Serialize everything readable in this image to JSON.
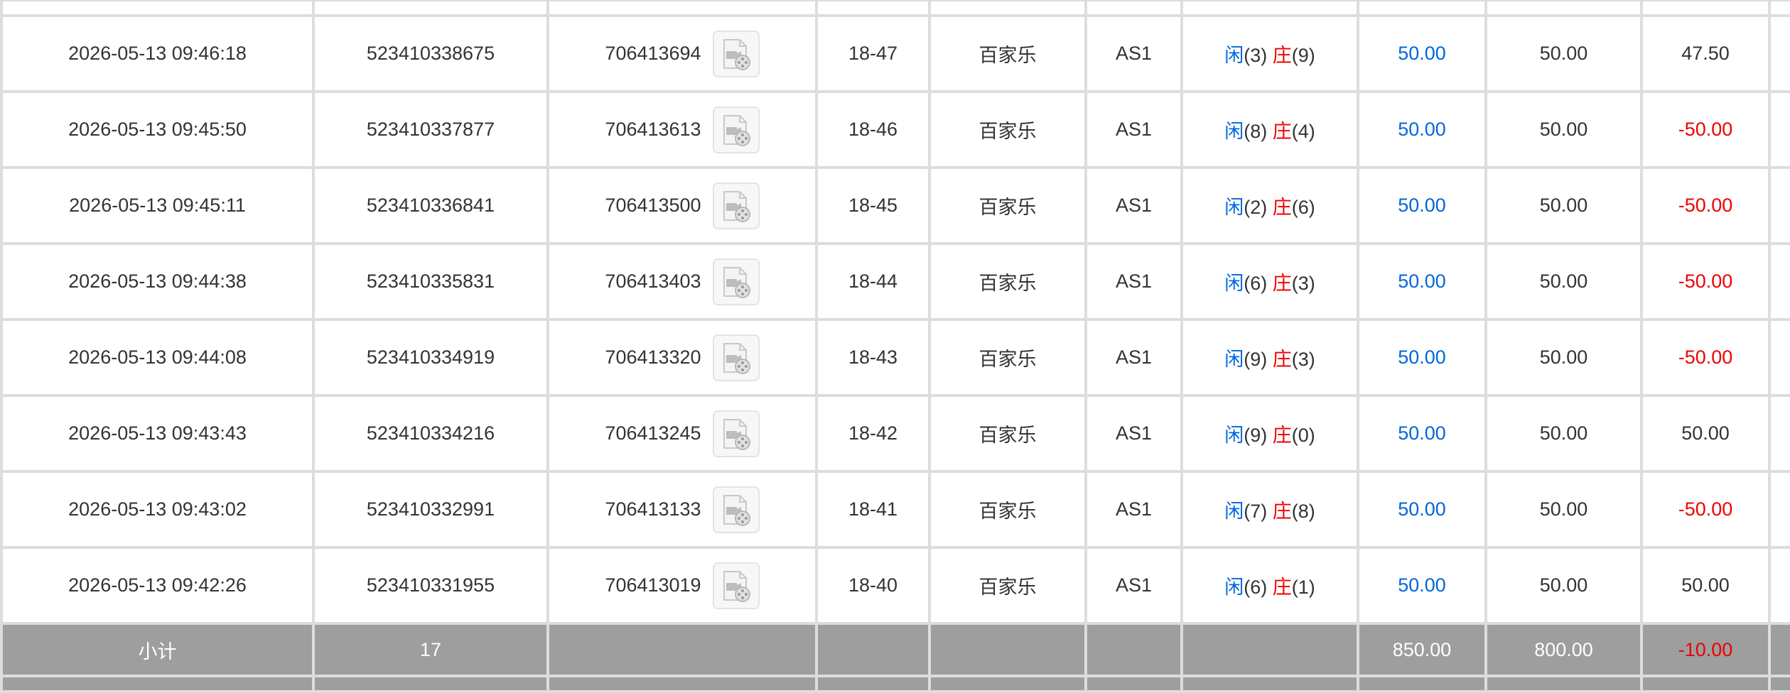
{
  "colors": {
    "blue": "#0066dd",
    "red": "#ee0000",
    "border": "#dddddd",
    "subtotal_bg": "#9e9e9e"
  },
  "icons": {
    "replay": "video-replay-icon"
  },
  "rows": [
    {
      "time": "2026-05-13 09:46:18",
      "order_no": "523410338675",
      "game_no": "706413694",
      "round": "18-47",
      "game_type": "百家乐",
      "table": "AS1",
      "player_label": "闲",
      "player_val": "(3)",
      "banker_label": "庄",
      "banker_val": "(9)",
      "bet": "50.00",
      "valid_bet": "50.00",
      "win_loss": "47.50",
      "win_negative": false
    },
    {
      "time": "2026-05-13 09:45:50",
      "order_no": "523410337877",
      "game_no": "706413613",
      "round": "18-46",
      "game_type": "百家乐",
      "table": "AS1",
      "player_label": "闲",
      "player_val": "(8)",
      "banker_label": "庄",
      "banker_val": "(4)",
      "bet": "50.00",
      "valid_bet": "50.00",
      "win_loss": "-50.00",
      "win_negative": true
    },
    {
      "time": "2026-05-13 09:45:11",
      "order_no": "523410336841",
      "game_no": "706413500",
      "round": "18-45",
      "game_type": "百家乐",
      "table": "AS1",
      "player_label": "闲",
      "player_val": "(2)",
      "banker_label": "庄",
      "banker_val": "(6)",
      "bet": "50.00",
      "valid_bet": "50.00",
      "win_loss": "-50.00",
      "win_negative": true
    },
    {
      "time": "2026-05-13 09:44:38",
      "order_no": "523410335831",
      "game_no": "706413403",
      "round": "18-44",
      "game_type": "百家乐",
      "table": "AS1",
      "player_label": "闲",
      "player_val": "(6)",
      "banker_label": "庄",
      "banker_val": "(3)",
      "bet": "50.00",
      "valid_bet": "50.00",
      "win_loss": "-50.00",
      "win_negative": true
    },
    {
      "time": "2026-05-13 09:44:08",
      "order_no": "523410334919",
      "game_no": "706413320",
      "round": "18-43",
      "game_type": "百家乐",
      "table": "AS1",
      "player_label": "闲",
      "player_val": "(9)",
      "banker_label": "庄",
      "banker_val": "(3)",
      "bet": "50.00",
      "valid_bet": "50.00",
      "win_loss": "-50.00",
      "win_negative": true
    },
    {
      "time": "2026-05-13 09:43:43",
      "order_no": "523410334216",
      "game_no": "706413245",
      "round": "18-42",
      "game_type": "百家乐",
      "table": "AS1",
      "player_label": "闲",
      "player_val": "(9)",
      "banker_label": "庄",
      "banker_val": "(0)",
      "bet": "50.00",
      "valid_bet": "50.00",
      "win_loss": "50.00",
      "win_negative": false
    },
    {
      "time": "2026-05-13 09:43:02",
      "order_no": "523410332991",
      "game_no": "706413133",
      "round": "18-41",
      "game_type": "百家乐",
      "table": "AS1",
      "player_label": "闲",
      "player_val": "(7)",
      "banker_label": "庄",
      "banker_val": "(8)",
      "bet": "50.00",
      "valid_bet": "50.00",
      "win_loss": "-50.00",
      "win_negative": true
    },
    {
      "time": "2026-05-13 09:42:26",
      "order_no": "523410331955",
      "game_no": "706413019",
      "round": "18-40",
      "game_type": "百家乐",
      "table": "AS1",
      "player_label": "闲",
      "player_val": "(6)",
      "banker_label": "庄",
      "banker_val": "(1)",
      "bet": "50.00",
      "valid_bet": "50.00",
      "win_loss": "50.00",
      "win_negative": false
    }
  ],
  "subtotal": {
    "label": "小计",
    "count": "17",
    "bet": "850.00",
    "valid_bet": "800.00",
    "win_loss": "-10.00"
  }
}
